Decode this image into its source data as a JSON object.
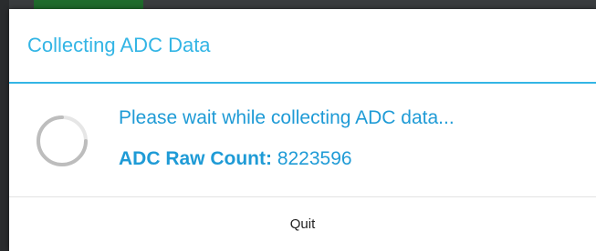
{
  "dialog": {
    "title": "Collecting ADC Data",
    "message": "Please wait while collecting ADC data...",
    "count_label": "ADC Raw Count:",
    "count_value": "8223596",
    "quit_label": "Quit",
    "spinner_icon": "progress-spinner-icon"
  },
  "colors": {
    "accent": "#33b5e5",
    "message_text": "#1f9bd6",
    "backdrop": "#3a3d3f"
  }
}
